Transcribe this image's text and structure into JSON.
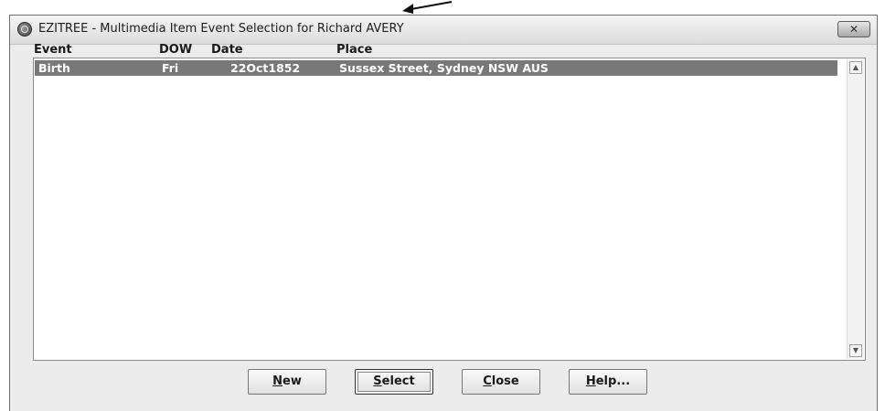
{
  "window": {
    "title": "EZITREE - Multimedia Item Event Selection for Richard AVERY",
    "close_label": "✕"
  },
  "list": {
    "columns": [
      "Event",
      "DOW",
      "Date",
      "Place"
    ],
    "rows": [
      {
        "event": "Birth",
        "dow": "Fri",
        "date": "22Oct1852",
        "place": "Sussex Street, Sydney NSW AUS",
        "selected": true
      }
    ],
    "scroll_up": "▲",
    "scroll_down": "▼"
  },
  "buttons": {
    "new": {
      "accel": "N",
      "rest": "ew"
    },
    "select": {
      "accel": "S",
      "rest": "elect"
    },
    "close": {
      "accel": "C",
      "rest": "lose"
    },
    "help": {
      "accel": "H",
      "rest": "elp..."
    }
  },
  "colors": {
    "selection": "#787878",
    "window_bg": "#ececec"
  }
}
